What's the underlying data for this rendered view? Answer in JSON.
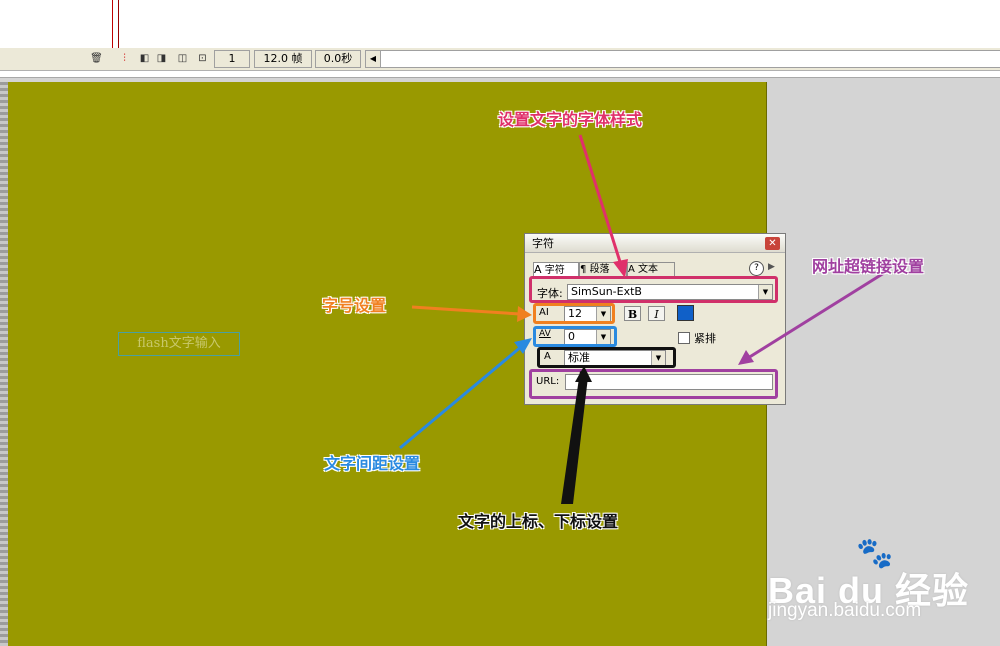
{
  "timeline": {
    "frame_number": "1",
    "frame_rate": "12.0 帧",
    "elapsed_time": "0.0秒",
    "icons": [
      "trash-icon",
      "center-frame-icon",
      "onion-skin-icon",
      "onion-skin-outline-icon",
      "edit-multiple-frames-icon",
      "modify-onion-markers-icon"
    ]
  },
  "stage": {
    "text_box": "flash文字输入",
    "background_color": "#999900"
  },
  "panel": {
    "title": "字符",
    "close_icon": "✕",
    "tabs": [
      "字符",
      "段落",
      "文本"
    ],
    "help_label": "?",
    "font_label": "字体:",
    "font_value": "SimSun-ExtB",
    "size_icon": "AI",
    "size_value": "12",
    "bold_label": "B",
    "italic_label": "I",
    "text_color": "#1060c8",
    "spacing_icon": "AV",
    "spacing_value": "0",
    "kerning_label": "紧排",
    "baseline_icon": "A",
    "baseline_value": "标准",
    "url_label": "URL:",
    "url_value": ""
  },
  "annotations": {
    "font_style": "设置文字的字体样式",
    "font_size": "字号设置",
    "letter_spacing": "文字间距设置",
    "baseline": "文字的上标、下标设置",
    "url": "网址超链接设置"
  },
  "annotation_colors": {
    "font_style": "#e0306a",
    "font_size": "#f08020",
    "letter_spacing": "#2a8ae0",
    "baseline": "#111111",
    "url": "#a040a0"
  },
  "watermark": {
    "logo": "Bai du 经验",
    "url": "jingyan.baidu.com"
  }
}
